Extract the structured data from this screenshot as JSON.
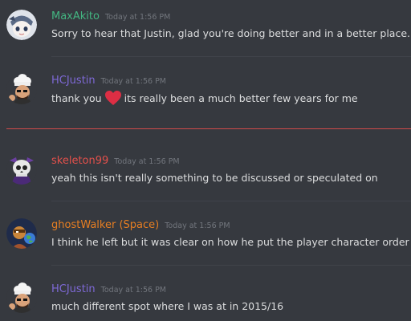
{
  "colors": {
    "background": "#36393f",
    "maxakito": "#43b581",
    "hcjustin": "#7e69d6",
    "skeleton99": "#e2504b",
    "ghostwalker": "#e67e22",
    "new_messages_divider": "#d24a4a"
  },
  "messages": [
    {
      "username": "MaxAkito",
      "timestamp": "Today at 1:56 PM",
      "text": "Sorry to hear that Justin, glad you're doing better and in a better place.",
      "avatar_icon": "anime-avatar-icon"
    },
    {
      "username": "HCJustin",
      "timestamp": "Today at 1:56 PM",
      "text_before": "thank you",
      "emoji": "red-heart-icon",
      "text_after": "its really been a much better few years for me",
      "avatar_icon": "chef-avatar-icon"
    },
    {
      "username": "skeleton99",
      "timestamp": "Today at 1:56 PM",
      "text": "yeah this isn't really something to be discussed or speculated on",
      "avatar_icon": "skeleton-avatar-icon"
    },
    {
      "username": "ghostWalker (Space)",
      "timestamp": "Today at 1:56 PM",
      "text": "I think he left but it was clear on how he put the player character order o",
      "avatar_icon": "cartoon-globe-avatar-icon"
    },
    {
      "username": "HCJustin",
      "timestamp": "Today at 1:56 PM",
      "text": "much different spot where I was at in 2015/16",
      "avatar_icon": "chef-avatar-icon"
    }
  ]
}
